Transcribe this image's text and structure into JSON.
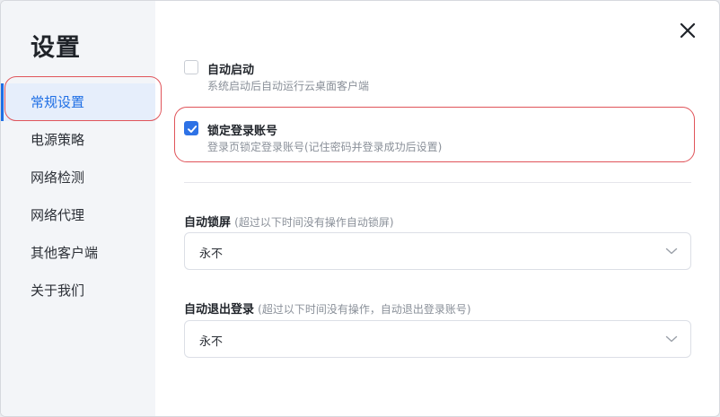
{
  "sidebar": {
    "title": "设置",
    "items": [
      {
        "label": "常规设置",
        "active": true
      },
      {
        "label": "电源策略"
      },
      {
        "label": "网络检测"
      },
      {
        "label": "网络代理"
      },
      {
        "label": "其他客户端"
      },
      {
        "label": "关于我们"
      }
    ]
  },
  "options": {
    "autostart": {
      "title": "自动启动",
      "desc": "系统启动后自动运行云桌面客户端",
      "checked": false
    },
    "lock_account": {
      "title": "锁定登录账号",
      "desc": "登录页锁定登录账号(记住密码并登录成功后设置)",
      "checked": true
    }
  },
  "auto_lock": {
    "label": "自动锁屏",
    "hint": "(超过以下时间没有操作自动锁屏)",
    "value": "永不"
  },
  "auto_logout": {
    "label": "自动退出登录",
    "hint": "(超过以下时间没有操作，自动退出登录账号)",
    "value": "永不"
  },
  "colors": {
    "accent": "#1f6fe5",
    "annotation": "#e0545a",
    "sidebar_bg": "#f3f5f8"
  },
  "icons": {
    "close": "close-icon",
    "check": "check-icon",
    "chevron": "chevron-down-icon"
  }
}
